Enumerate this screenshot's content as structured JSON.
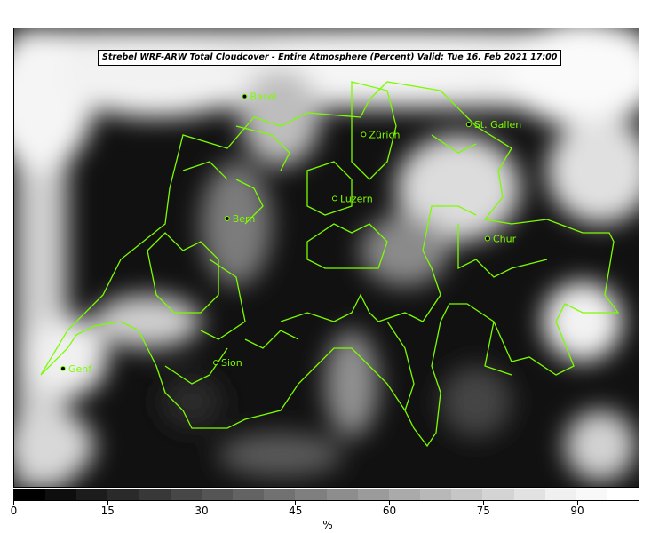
{
  "title": "Strebel WRF-ARW Total Cloudcover - Entire Atmosphere (Percent)   Valid: Tue 16. Feb 2021 17:00",
  "colorbar": {
    "label": "%",
    "ticks": [
      "0",
      "15",
      "30",
      "45",
      "60",
      "75",
      "90"
    ],
    "tick_values": [
      0,
      15,
      30,
      45,
      60,
      75,
      90
    ],
    "range": [
      0,
      100
    ],
    "colors": [
      "#000000",
      "#0e0e0e",
      "#1c1c1c",
      "#2a2a2a",
      "#383838",
      "#474747",
      "#555555",
      "#636363",
      "#717171",
      "#7f7f7f",
      "#8d8d8d",
      "#9b9b9b",
      "#aaaaaa",
      "#b8b8b8",
      "#c6c6c6",
      "#d4d4d4",
      "#e2e2e2",
      "#f0f0f0",
      "#f8f8f8",
      "#ffffff"
    ]
  },
  "cities": [
    {
      "name": "Basel",
      "lon": 7.59,
      "lat": 47.56
    },
    {
      "name": "Zürich",
      "lon": 8.54,
      "lat": 47.37
    },
    {
      "name": "St. Gallen",
      "lon": 9.38,
      "lat": 47.42
    },
    {
      "name": "Luzern",
      "lon": 8.31,
      "lat": 47.05
    },
    {
      "name": "Bern",
      "lon": 7.45,
      "lat": 46.95
    },
    {
      "name": "Chur",
      "lon": 9.53,
      "lat": 46.85
    },
    {
      "name": "Genf",
      "lon": 6.14,
      "lat": 46.2
    },
    {
      "name": "Sion",
      "lon": 7.36,
      "lat": 46.23
    }
  ],
  "border_color": "#7cfc00",
  "background_color": "#111111"
}
